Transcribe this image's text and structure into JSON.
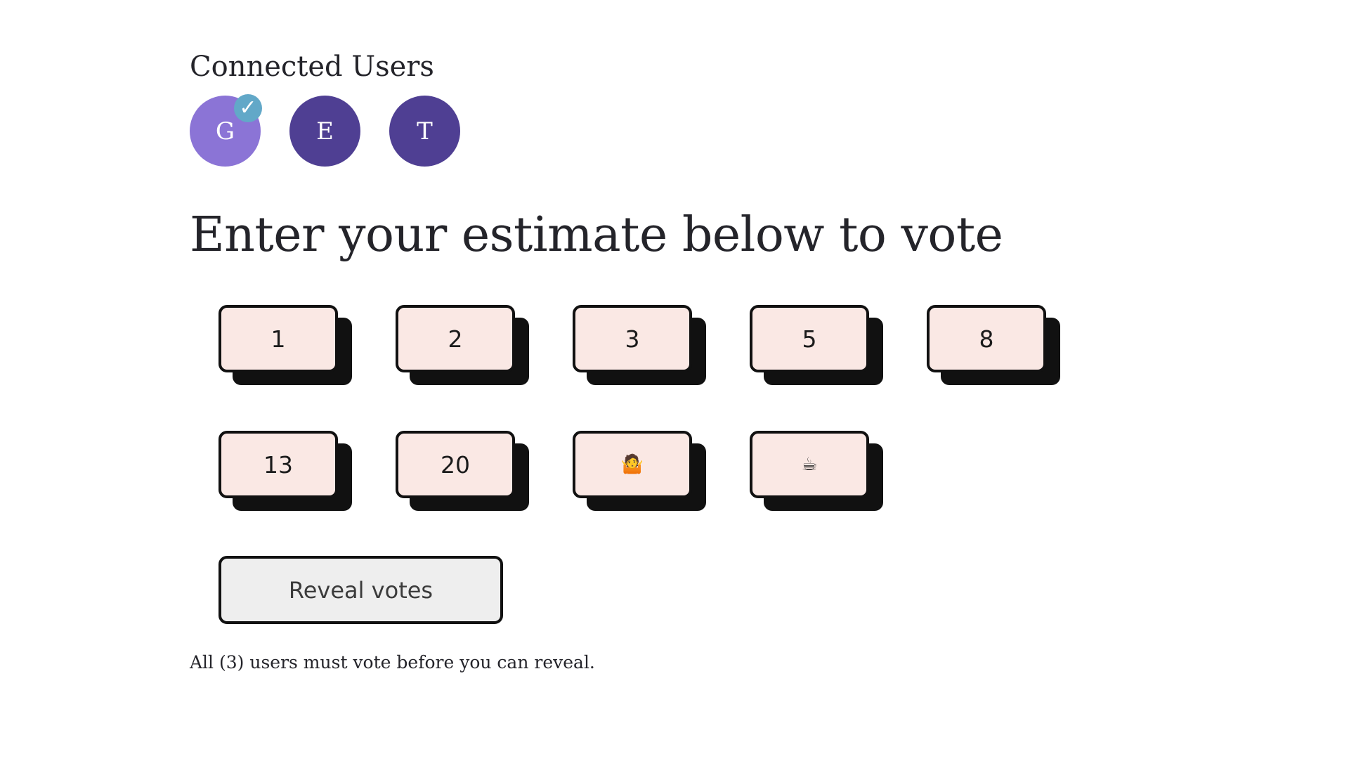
{
  "users": {
    "heading": "Connected Users",
    "list": [
      {
        "initial": "G",
        "voted": true,
        "check_icon": "check-icon"
      },
      {
        "initial": "E",
        "voted": false
      },
      {
        "initial": "T",
        "voted": false
      }
    ],
    "colors": {
      "voted": "#8b74d6",
      "pending": "#4f3f93",
      "check_badge": "#62a8c8"
    }
  },
  "vote": {
    "heading": "Enter your estimate below to vote",
    "cards_row1": [
      "1",
      "2",
      "3",
      "5",
      "8"
    ],
    "cards_row2": [
      "13",
      "20",
      "🤷",
      "☕"
    ],
    "card_color": "#fae8e4"
  },
  "reveal": {
    "button_label": "Reveal votes",
    "note": "All (3) users must vote before you can reveal."
  }
}
